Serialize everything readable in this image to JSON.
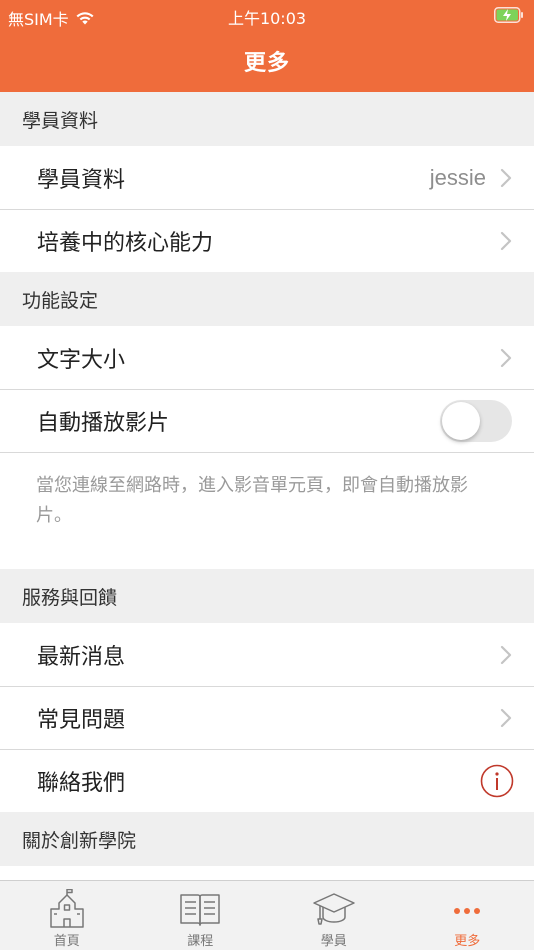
{
  "status_bar": {
    "carrier": "無SIM卡",
    "time": "上午10:03"
  },
  "nav": {
    "title": "更多"
  },
  "sections": {
    "student": {
      "header": "學員資料",
      "row_profile": {
        "label": "學員資料",
        "value": "jessie"
      },
      "row_skills": {
        "label": "培養中的核心能力"
      }
    },
    "settings": {
      "header": "功能設定",
      "row_text_size": {
        "label": "文字大小"
      },
      "row_autoplay": {
        "label": "自動播放影片",
        "enabled": false
      },
      "footnote": "當您連線至網路時，進入影音單元頁，即會自動播放影片。"
    },
    "service": {
      "header": "服務與回饋",
      "row_news": {
        "label": "最新消息"
      },
      "row_faq": {
        "label": "常見問題"
      },
      "row_contact": {
        "label": "聯絡我們"
      }
    },
    "about": {
      "header": "關於創新學院"
    }
  },
  "tabbar": [
    {
      "label": "首頁",
      "icon": "school-icon",
      "active": false
    },
    {
      "label": "課程",
      "icon": "book-icon",
      "active": false
    },
    {
      "label": "學員",
      "icon": "graduation-cap-icon",
      "active": false
    },
    {
      "label": "更多",
      "icon": "more-dots-icon",
      "active": true
    }
  ],
  "colors": {
    "brand": "#ef6c3b",
    "accent_info": "#c0392b"
  }
}
